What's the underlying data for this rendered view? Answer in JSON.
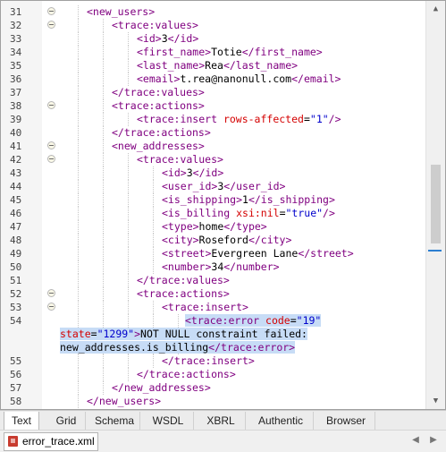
{
  "editor": {
    "lines": [
      {
        "num": "31",
        "indent": 2,
        "html": [
          [
            "tag",
            "<new_users>"
          ]
        ]
      },
      {
        "num": "32",
        "indent": 3,
        "html": [
          [
            "tag",
            "<trace:values>"
          ]
        ]
      },
      {
        "num": "33",
        "indent": 4,
        "html": [
          [
            "tag",
            "<id>"
          ],
          [
            "txt",
            "3"
          ],
          [
            "tag",
            "</id>"
          ]
        ]
      },
      {
        "num": "34",
        "indent": 4,
        "html": [
          [
            "tag",
            "<first_name>"
          ],
          [
            "txt",
            "Totie"
          ],
          [
            "tag",
            "</first_name>"
          ]
        ]
      },
      {
        "num": "35",
        "indent": 4,
        "html": [
          [
            "tag",
            "<last_name>"
          ],
          [
            "txt",
            "Rea"
          ],
          [
            "tag",
            "</last_name>"
          ]
        ]
      },
      {
        "num": "36",
        "indent": 4,
        "html": [
          [
            "tag",
            "<email>"
          ],
          [
            "txt",
            "t.rea@nanonull.com"
          ],
          [
            "tag",
            "</email>"
          ]
        ]
      },
      {
        "num": "37",
        "indent": 3,
        "html": [
          [
            "tag",
            "</trace:values>"
          ]
        ]
      },
      {
        "num": "38",
        "indent": 3,
        "html": [
          [
            "tag",
            "<trace:actions>"
          ]
        ]
      },
      {
        "num": "39",
        "indent": 4,
        "html": [
          [
            "tag",
            "<trace:insert "
          ],
          [
            "attr",
            "rows-affected"
          ],
          [
            "txt",
            "="
          ],
          [
            "val",
            "\"1\""
          ],
          [
            "tag",
            "/>"
          ]
        ]
      },
      {
        "num": "40",
        "indent": 3,
        "html": [
          [
            "tag",
            "</trace:actions>"
          ]
        ]
      },
      {
        "num": "41",
        "indent": 3,
        "html": [
          [
            "tag",
            "<new_addresses>"
          ]
        ]
      },
      {
        "num": "42",
        "indent": 4,
        "html": [
          [
            "tag",
            "<trace:values>"
          ]
        ]
      },
      {
        "num": "43",
        "indent": 5,
        "html": [
          [
            "tag",
            "<id>"
          ],
          [
            "txt",
            "3"
          ],
          [
            "tag",
            "</id>"
          ]
        ]
      },
      {
        "num": "44",
        "indent": 5,
        "html": [
          [
            "tag",
            "<user_id>"
          ],
          [
            "txt",
            "3"
          ],
          [
            "tag",
            "</user_id>"
          ]
        ]
      },
      {
        "num": "45",
        "indent": 5,
        "html": [
          [
            "tag",
            "<is_shipping>"
          ],
          [
            "txt",
            "1"
          ],
          [
            "tag",
            "</is_shipping>"
          ]
        ]
      },
      {
        "num": "46",
        "indent": 5,
        "html": [
          [
            "tag",
            "<is_billing "
          ],
          [
            "attr",
            "xsi:nil"
          ],
          [
            "txt",
            "="
          ],
          [
            "val",
            "\"true\""
          ],
          [
            "tag",
            "/>"
          ]
        ]
      },
      {
        "num": "47",
        "indent": 5,
        "html": [
          [
            "tag",
            "<type>"
          ],
          [
            "txt",
            "home"
          ],
          [
            "tag",
            "</type>"
          ]
        ]
      },
      {
        "num": "48",
        "indent": 5,
        "html": [
          [
            "tag",
            "<city>"
          ],
          [
            "txt",
            "Roseford"
          ],
          [
            "tag",
            "</city>"
          ]
        ]
      },
      {
        "num": "49",
        "indent": 5,
        "html": [
          [
            "tag",
            "<street>"
          ],
          [
            "txt",
            "Evergreen Lane"
          ],
          [
            "tag",
            "</street>"
          ]
        ]
      },
      {
        "num": "50",
        "indent": 5,
        "html": [
          [
            "tag",
            "<number>"
          ],
          [
            "txt",
            "34"
          ],
          [
            "tag",
            "</number>"
          ]
        ]
      },
      {
        "num": "51",
        "indent": 4,
        "html": [
          [
            "tag",
            "</trace:values>"
          ]
        ]
      },
      {
        "num": "52",
        "indent": 4,
        "html": [
          [
            "tag",
            "<trace:actions>"
          ]
        ]
      },
      {
        "num": "53",
        "indent": 5,
        "html": [
          [
            "tag",
            "<trace:insert>"
          ]
        ]
      },
      {
        "num": "54",
        "indent": 6,
        "multi": true,
        "html": [
          [
            "tag",
            "<trace:error "
          ],
          [
            "attr",
            "code"
          ],
          [
            "txt",
            "="
          ],
          [
            "val",
            "\"19\""
          ],
          [
            "br",
            ""
          ],
          [
            "attr",
            "state"
          ],
          [
            "txt",
            "="
          ],
          [
            "val",
            "\"1299\""
          ],
          [
            "tag",
            ">"
          ],
          [
            "txt",
            "NOT NULL constraint failed:"
          ],
          [
            "br",
            ""
          ],
          [
            "txt",
            "new_addresses.is_billing"
          ],
          [
            "tag",
            "</trace:error>"
          ]
        ]
      },
      {
        "num": "55",
        "indent": 5,
        "html": [
          [
            "tag",
            "</trace:insert>"
          ]
        ]
      },
      {
        "num": "56",
        "indent": 4,
        "html": [
          [
            "tag",
            "</trace:actions>"
          ]
        ]
      },
      {
        "num": "57",
        "indent": 3,
        "html": [
          [
            "tag",
            "</new_addresses>"
          ]
        ]
      },
      {
        "num": "58",
        "indent": 2,
        "html": [
          [
            "tag",
            "</new_users>"
          ]
        ]
      }
    ]
  },
  "view_tabs": [
    {
      "label": "Text",
      "active": true
    },
    {
      "label": "Grid",
      "active": false
    },
    {
      "label": "Schema",
      "active": false
    },
    {
      "label": "WSDL",
      "active": false
    },
    {
      "label": "XBRL",
      "active": false
    },
    {
      "label": "Authentic",
      "active": false
    },
    {
      "label": "Browser",
      "active": false
    }
  ],
  "file_tab": {
    "name": "error_trace.xml"
  },
  "icons": {
    "scroll_up": "triangle-up-icon",
    "scroll_down": "triangle-down-icon",
    "nav_prev": "chevron-left-icon",
    "nav_next": "chevron-right-icon",
    "file": "xml-file-icon"
  }
}
